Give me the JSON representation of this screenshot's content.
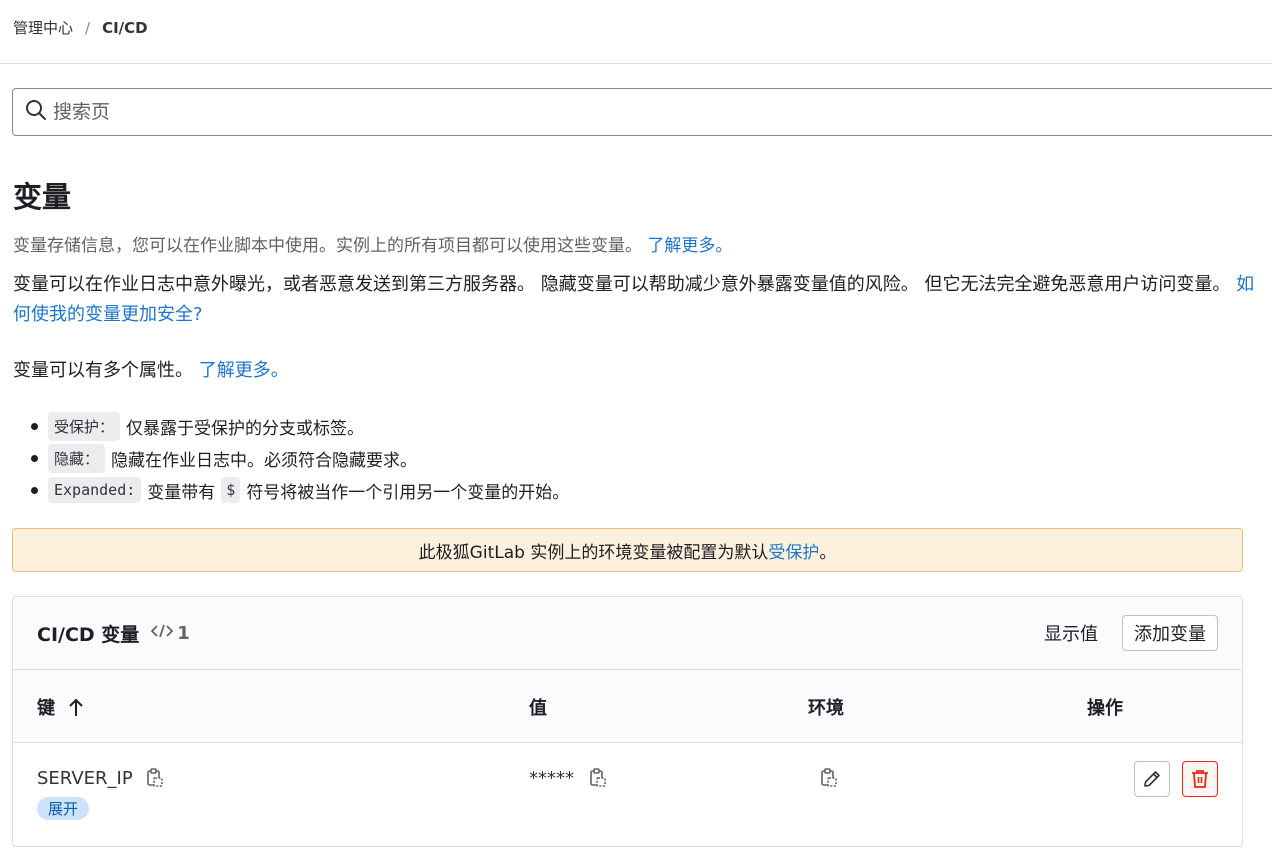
{
  "breadcrumb": {
    "parent": "管理中心",
    "separator": "/",
    "current": "CI/CD"
  },
  "search": {
    "placeholder": "搜索页"
  },
  "page": {
    "title": "变量",
    "intro": "变量存储信息，您可以在作业脚本中使用。实例上的所有项目都可以使用这些变量。",
    "intro_link": "了解更多。",
    "security_text": "变量可以在作业日志中意外曝光，或者恶意发送到第三方服务器。 隐藏变量可以帮助减少意外暴露变量值的风险。 但它无法完全避免恶意用户访问变量。",
    "security_link": "如何使我的变量更加安全?",
    "attrs_text": "变量可以有多个属性。",
    "attrs_link": "了解更多。",
    "attributes": [
      {
        "code": "受保护：",
        "desc": "仅暴露于受保护的分支或标签。"
      },
      {
        "code": "隐藏：",
        "desc": "隐藏在作业日志中。必须符合隐藏要求。"
      },
      {
        "code": "Expanded:",
        "desc_before": "变量带有",
        "dollar": "$",
        "desc_after": "符号将被当作一个引用另一个变量的开始。"
      }
    ]
  },
  "alert": {
    "text": "此极狐GitLab 实例上的环境变量被配置为默认",
    "link": "受保护",
    "suffix": "。"
  },
  "variables_card": {
    "title": "CI/CD 变量",
    "count": "1",
    "reveal_label": "显示值",
    "add_label": "添加变量",
    "columns": {
      "key": "键",
      "value": "值",
      "environment": "环境",
      "actions": "操作"
    },
    "rows": [
      {
        "key": "SERVER_IP",
        "badge": "展开",
        "value": "*****"
      }
    ]
  },
  "colors": {
    "link": "#1f75cb",
    "alert_bg": "#fdf1dd",
    "badge_bg": "#cbe2f9",
    "danger": "#dd2b0e"
  }
}
